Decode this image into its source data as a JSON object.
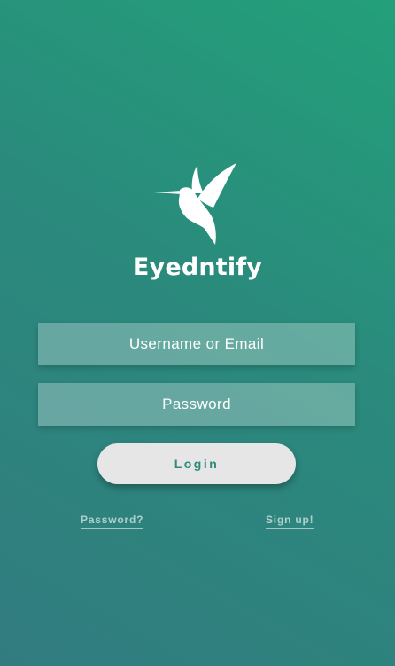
{
  "app": {
    "name": "Eyedntify",
    "logo_icon": "hummingbird-icon"
  },
  "form": {
    "username_placeholder": "Username or Email",
    "password_placeholder": "Password",
    "login_label": "Login"
  },
  "links": {
    "forgot_password": "Password?",
    "sign_up": "Sign up!"
  },
  "colors": {
    "background_start": "#23a07a",
    "background_end": "#327c80",
    "button_background": "#e6e6e6",
    "button_text": "#2f8a7d"
  }
}
